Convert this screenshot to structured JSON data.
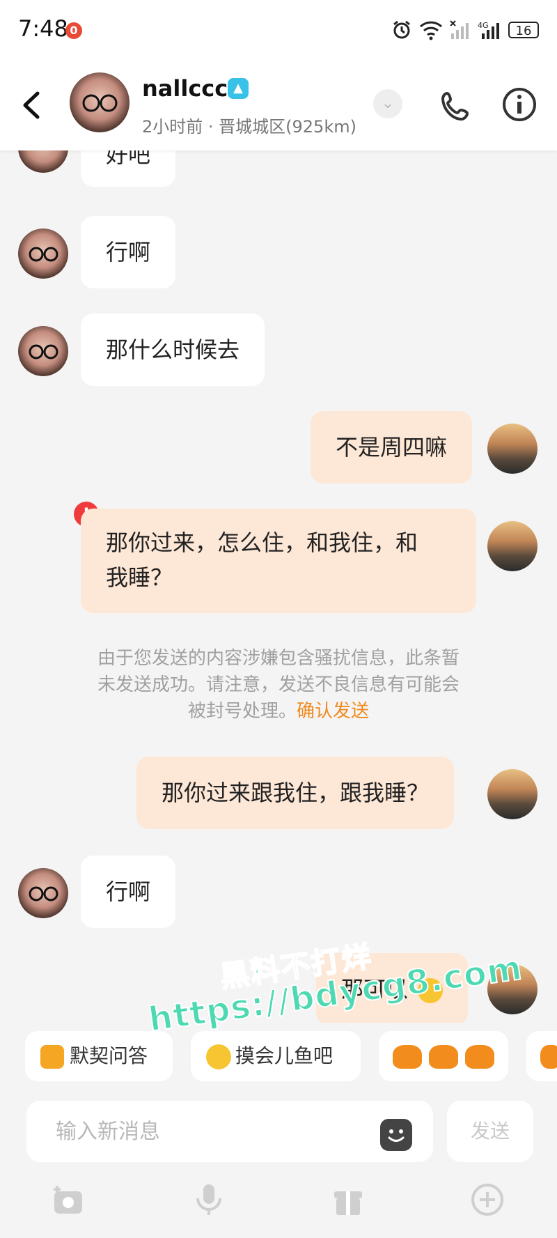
{
  "status_bar": {
    "time": "7:48",
    "notification_count": "0",
    "battery": "16"
  },
  "header": {
    "name": "nallccc",
    "subtitle": "2小时前 · 晋城城区(925km)"
  },
  "messages": [
    {
      "side": "her",
      "text": "好吧"
    },
    {
      "side": "her",
      "text": "行啊"
    },
    {
      "side": "her",
      "text": "那什么时候去"
    },
    {
      "side": "me",
      "text": "不是周四嘛"
    },
    {
      "side": "me",
      "text": "那你过来，怎么住，和我住，和我睡？",
      "line1": "那你过来，怎么住，和我住，和",
      "line2": "我睡？",
      "failed": true
    },
    {
      "side": "me",
      "text": "那你过来跟我住，跟我睡？"
    },
    {
      "side": "her",
      "text": "行啊"
    },
    {
      "side": "me",
      "text": "那可以"
    }
  ],
  "notice": {
    "line1": "由于您发送的内容涉嫌包含骚扰信息，此条暂",
    "line2": "未发送成功。请注意，发送不良信息有可能会",
    "line3_prefix": "被封号处理。",
    "link": "确认发送"
  },
  "watermark": {
    "line1": "黑料不打烊",
    "line2": "https://bdycg8.com"
  },
  "quick_replies": [
    {
      "label": "默契问答",
      "icon": "quiz-icon"
    },
    {
      "label": "摸会儿鱼吧",
      "icon": "slacking-emoji-icon"
    },
    {
      "label": "",
      "icon": "crab-emoji-icon"
    }
  ],
  "input": {
    "placeholder": "输入新消息",
    "send_label": "发送"
  },
  "colors": {
    "my_bubble": "#fde7d6",
    "her_bubble": "#ffffff",
    "link": "#f08a1d",
    "warning": "#ef3b3b",
    "verified": "#39c2e7"
  }
}
